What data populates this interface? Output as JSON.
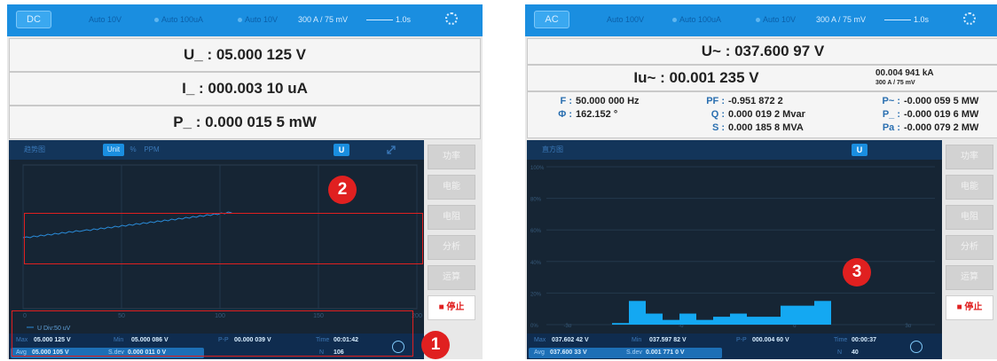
{
  "panels": [
    {
      "mode": "DC",
      "topbar": {
        "range1": "Auto 10V",
        "range2": "Auto 100uA",
        "range3": "Auto 10V",
        "ct": "300 A / 75 mV",
        "interval": "1.0s"
      },
      "readings": {
        "voltage": "U_ : 05.000 125 V",
        "current": "I_ : 000.003 10 uA",
        "power": "P_ : 0.000 015 5 mW"
      },
      "plot": {
        "title": "趋势图",
        "unit_btn": "Unit",
        "pct_btn": "%",
        "ppm_btn": "PPM",
        "u_btn": "U",
        "x_ticks": [
          "0",
          "50",
          "100",
          "150",
          "200"
        ],
        "legend": "U  Div:50 uV"
      },
      "stats": {
        "max_label": "Max",
        "max_value": "05.000 125 V",
        "min_label": "Min",
        "min_value": "05.000 086 V",
        "pp_label": "P-P",
        "pp_value": "00.000 039 V",
        "time_label": "Time",
        "time_value": "00:01:42",
        "avg_label": "Avg",
        "avg_value": "05.000 105 V",
        "sdev_label": "S.dev",
        "sdev_value": "0.000 011 0 V",
        "n_label": "N",
        "n_value": "106"
      },
      "side_buttons": [
        "功率",
        "电能",
        "电阻",
        "分析",
        "运算"
      ],
      "stop_button": "■ 停止",
      "annotations": [
        "2",
        "1"
      ],
      "chart_data": {
        "type": "line",
        "series": [
          {
            "name": "U",
            "values": [
              4,
              5,
              4,
              6,
              5,
              7,
              6,
              8,
              7,
              9,
              8,
              10,
              9,
              11,
              10,
              12,
              11,
              12,
              13,
              12,
              14,
              13,
              15,
              14,
              16,
              15,
              17,
              16,
              18,
              17,
              19,
              18,
              20,
              19,
              21,
              20,
              22,
              21,
              23,
              22,
              24,
              23,
              25,
              24,
              26,
              25,
              27,
              26,
              28,
              27,
              29,
              28,
              30,
              29,
              31,
              30,
              32,
              31,
              33,
              32
            ]
          }
        ],
        "x_range": [
          0,
          200
        ]
      }
    },
    {
      "mode": "AC",
      "topbar": {
        "range1": "Auto 100V",
        "range2": "Auto 100uA",
        "range3": "Auto 10V",
        "ct": "300 A / 75 mV",
        "interval": "1.0s"
      },
      "readings": {
        "voltage": "U~ : 037.600 97 V",
        "current": "Iu~ : 00.001 235 V",
        "current_side": "00.004 941 kA",
        "current_side_sub": "300 A / 75 mV"
      },
      "info": {
        "f_label": "F :",
        "f_value": "50.000 000 Hz",
        "phi_label": "Φ :",
        "phi_value": "162.152 °",
        "pf_label": "PF :",
        "pf_value": "-0.951 872 2",
        "q_label": "Q :",
        "q_value": "0.000 019 2 Mvar",
        "s_label": "S :",
        "s_value": "0.000 185 8 MVA",
        "pac_label": "P~ :",
        "pac_value": "-0.000 059 5 MW",
        "pdc_label": "P_ :",
        "pdc_value": "-0.000 019 6 MW",
        "ps_label": "Pa :",
        "ps_value": "-0.000 079 2 MW"
      },
      "plot": {
        "title": "直方图",
        "u_btn": "U",
        "y_ticks": [
          "100%",
          "80%",
          "60%",
          "40%",
          "20%",
          "0%"
        ],
        "x_ticks": [
          "-3σ",
          "-σ",
          "σ",
          "3σ"
        ]
      },
      "stats": {
        "max_label": "Max",
        "max_value": "037.602 42 V",
        "min_label": "Min",
        "min_value": "037.597 82 V",
        "pp_label": "P-P",
        "pp_value": "000.004 60 V",
        "time_label": "Time",
        "time_value": "00:00:37",
        "avg_label": "Avg",
        "avg_value": "037.600 33 V",
        "sdev_label": "S.dev",
        "sdev_value": "0.001 771 0 V",
        "n_label": "N",
        "n_value": "40"
      },
      "side_buttons": [
        "功率",
        "电能",
        "电阻",
        "分析",
        "运算"
      ],
      "stop_button": "■ 停止",
      "annotations": [
        "3"
      ],
      "chart_data": {
        "type": "bar",
        "values": [
          1,
          15,
          7,
          3,
          7,
          3,
          5,
          7,
          5,
          5,
          12,
          12,
          15
        ],
        "ylim": [
          0,
          100
        ]
      }
    }
  ],
  "colors": {
    "accent": "#1a8ee0",
    "plot_bg": "#162534",
    "trace": "#2a8bd8",
    "histogram": "#14a8f2",
    "annotation": "#e02020"
  }
}
